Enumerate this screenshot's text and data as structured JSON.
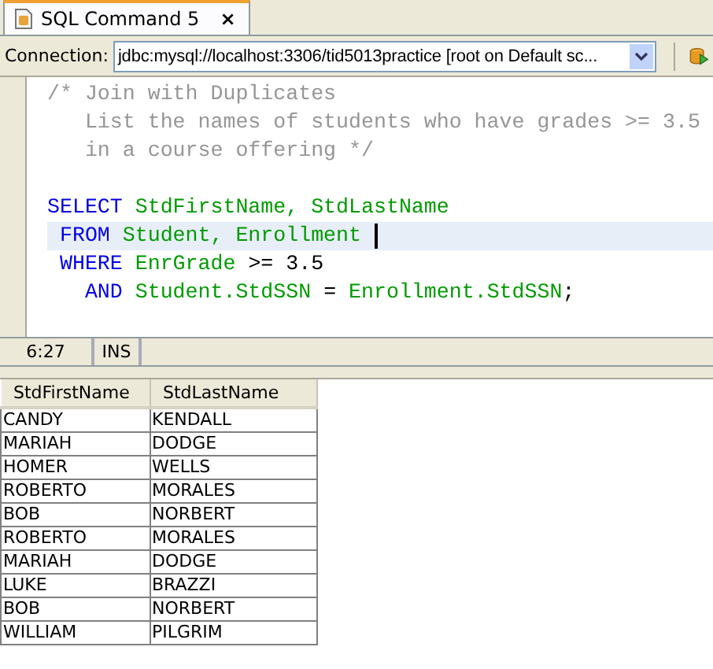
{
  "tab": {
    "title": "SQL Command 5",
    "close": "×",
    "selected": true
  },
  "connection": {
    "label": "Connection:",
    "value": "jdbc:mysql://localhost:3306/tid5013practice [root on Default sc..."
  },
  "editor": {
    "lines": [
      {
        "current": false,
        "tokens": [
          {
            "kind": "comment",
            "text": "/* Join with Duplicates"
          }
        ]
      },
      {
        "current": false,
        "tokens": [
          {
            "kind": "comment",
            "text": "   List the names of students who have grades >= 3.5"
          }
        ]
      },
      {
        "current": false,
        "tokens": [
          {
            "kind": "comment",
            "text": "   in a course offering */"
          }
        ]
      },
      {
        "current": false
      },
      {
        "current": false,
        "tokens": [
          {
            "kind": "keyword",
            "text": "SELECT"
          },
          {
            "kind": "ident",
            "text": " StdFirstName, StdLastName"
          }
        ]
      },
      {
        "current": true,
        "tokens": [
          {
            "kind": "keyword",
            "text": " FROM"
          },
          {
            "kind": "ident",
            "text": " Student, Enrollment"
          }
        ]
      },
      {
        "current": false,
        "tokens": [
          {
            "kind": "keyword",
            "text": " WHERE"
          },
          {
            "kind": "ident",
            "text": " EnrGrade"
          },
          {
            "kind": "plain",
            "text": " >= 3.5"
          }
        ]
      },
      {
        "current": false,
        "tokens": [
          {
            "kind": "keyword",
            "text": "   AND"
          },
          {
            "kind": "ident",
            "text": " Student.StdSSN"
          },
          {
            "kind": "plain",
            "text": " = "
          },
          {
            "kind": "ident",
            "text": "Enrollment.StdSSN"
          },
          {
            "kind": "plain",
            "text": ";"
          }
        ]
      }
    ]
  },
  "status_bar": {
    "position": "6:27",
    "mode": "INS"
  },
  "table": {
    "columns": [
      "StdFirstName",
      "StdLastName"
    ],
    "rows": [
      [
        "CANDY",
        "KENDALL"
      ],
      [
        "MARIAH",
        "DODGE"
      ],
      [
        "HOMER",
        "WELLS"
      ],
      [
        "ROBERTO",
        "MORALES"
      ],
      [
        "BOB",
        "NORBERT"
      ],
      [
        "ROBERTO",
        "MORALES"
      ],
      [
        "MARIAH",
        "DODGE"
      ],
      [
        "LUKE",
        "BRAZZI"
      ],
      [
        "BOB",
        "NORBERT"
      ],
      [
        "WILLIAM",
        "PILGRIM"
      ]
    ]
  }
}
